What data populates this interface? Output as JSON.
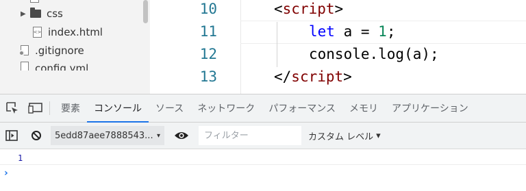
{
  "file_tree": {
    "items": [
      {
        "label": "css",
        "type": "folder",
        "collapsed": true
      },
      {
        "label": "index.html",
        "type": "file"
      },
      {
        "label": ".gitignore",
        "type": "file"
      },
      {
        "label": "config.yml",
        "type": "file",
        "partially_visible": true
      }
    ]
  },
  "editor": {
    "lines": [
      {
        "number": "10",
        "tokens": [
          {
            "t": "<",
            "c": ""
          },
          {
            "t": "script",
            "c": "tag"
          },
          {
            "t": ">",
            "c": ""
          }
        ]
      },
      {
        "number": "11",
        "tokens": [
          {
            "t": "let",
            "c": "kw"
          },
          {
            "t": " a = ",
            "c": ""
          },
          {
            "t": "1",
            "c": "num"
          },
          {
            "t": ";",
            "c": ""
          }
        ]
      },
      {
        "number": "12",
        "tokens": [
          {
            "t": "console.log(a);",
            "c": ""
          }
        ]
      },
      {
        "number": "13",
        "tokens": [
          {
            "t": "</",
            "c": ""
          },
          {
            "t": "script",
            "c": "tag"
          },
          {
            "t": ">",
            "c": ""
          }
        ]
      }
    ]
  },
  "devtools": {
    "tabs": [
      {
        "label": "要素",
        "active": false
      },
      {
        "label": "コンソール",
        "active": true
      },
      {
        "label": "ソース",
        "active": false
      },
      {
        "label": "ネットワーク",
        "active": false
      },
      {
        "label": "パフォーマンス",
        "active": false
      },
      {
        "label": "メモリ",
        "active": false
      },
      {
        "label": "アプリケーション",
        "active": false
      }
    ],
    "icons": {
      "inspect": "inspect-element-icon",
      "device": "device-toolbar-icon"
    }
  },
  "console_toolbar": {
    "context": "5edd87aee7888543...",
    "filter_placeholder": "フィルター",
    "filter_value": "",
    "levels_label": "カスタム レベル",
    "levels_caret": "▾",
    "context_caret": "▾"
  },
  "console_output": {
    "entries": [
      "1"
    ],
    "prompt": "›"
  },
  "colors": {
    "accent": "#1a73e8",
    "line_number": "#237893",
    "tag": "#800000",
    "keyword": "#0000ff",
    "number": "#098658",
    "log_number": "#1a1aa6"
  }
}
